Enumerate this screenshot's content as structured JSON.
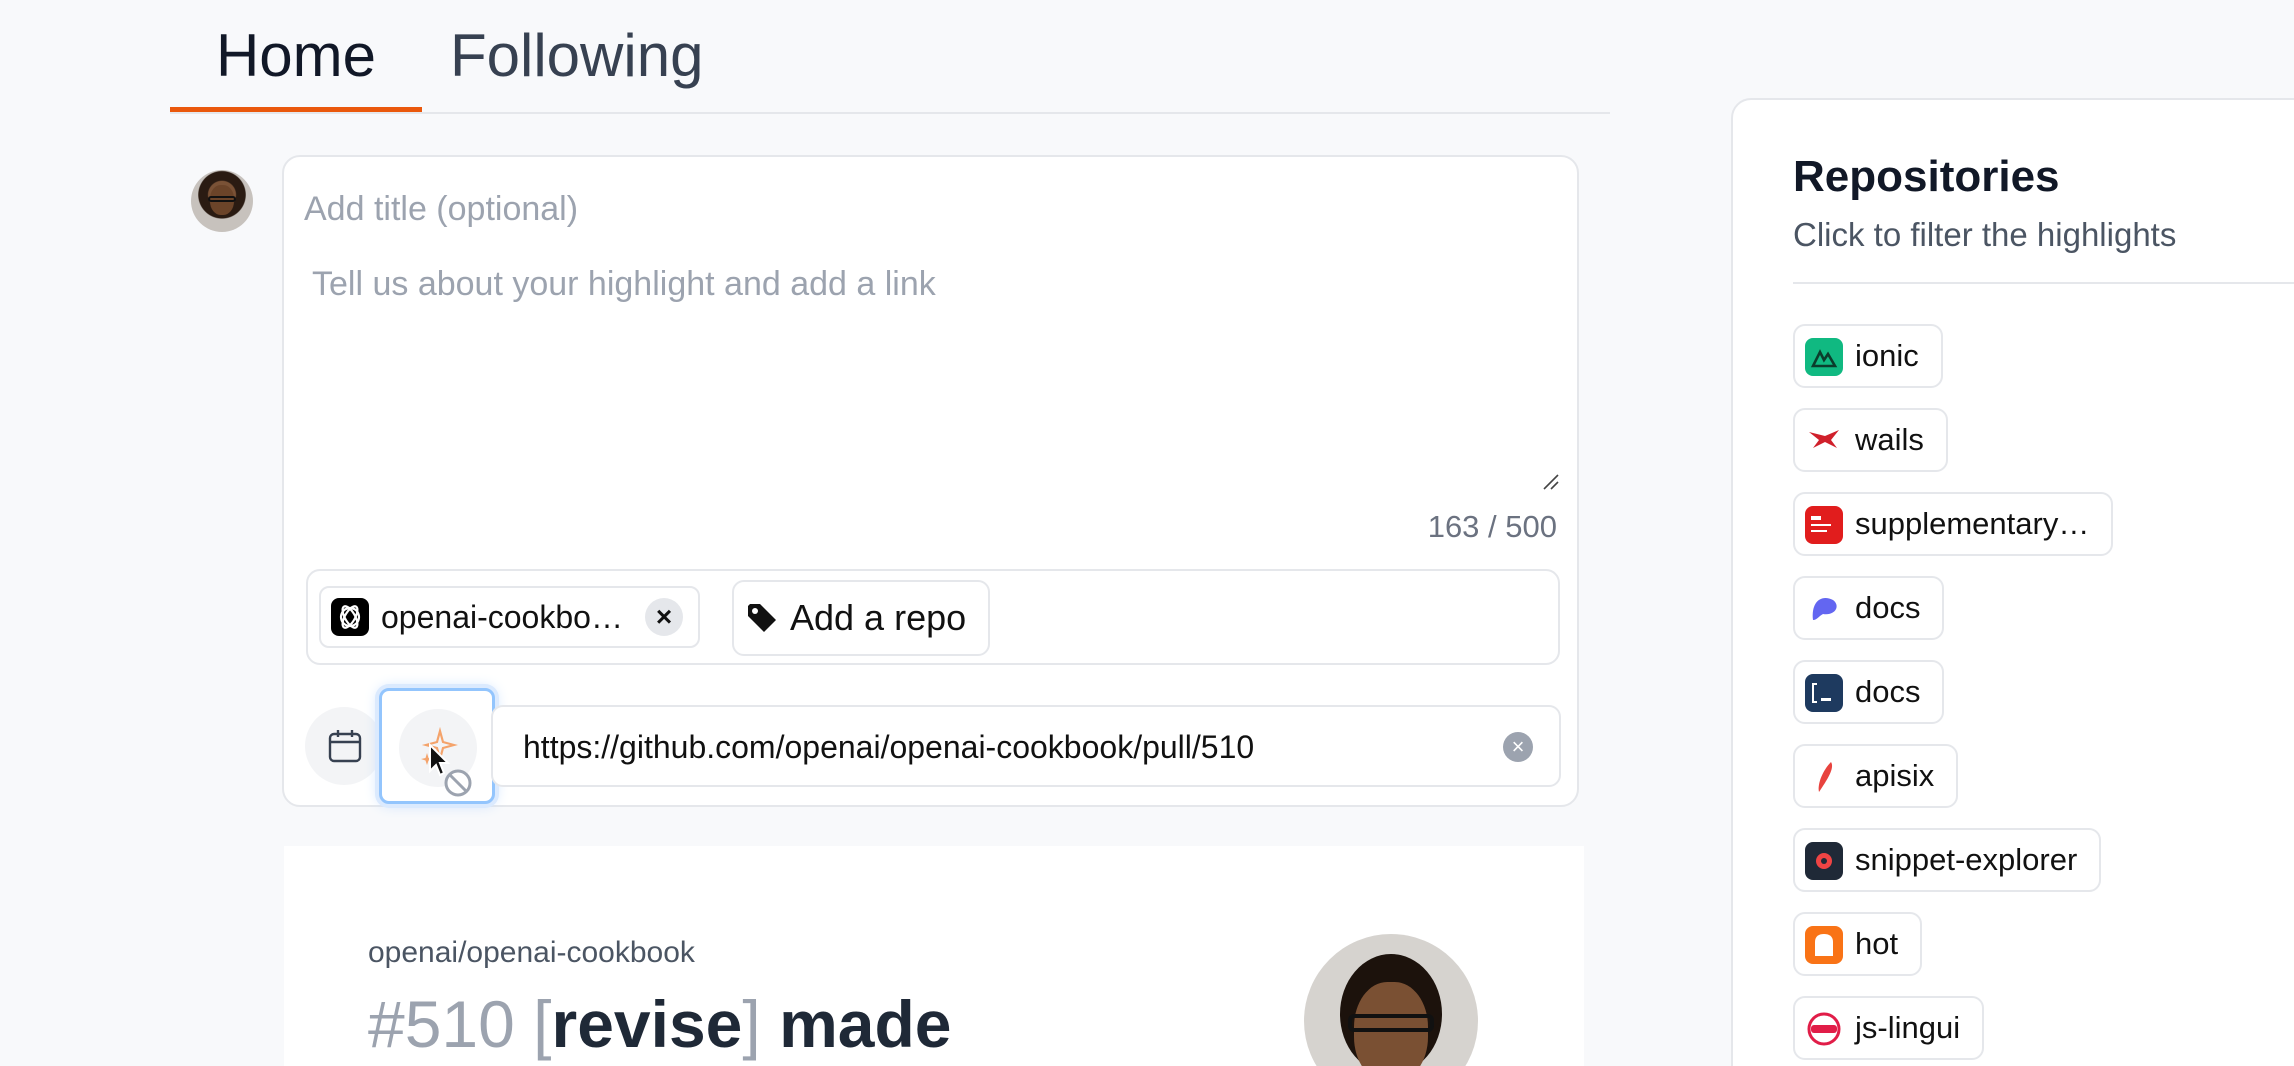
{
  "tabs": [
    {
      "label": "Home",
      "active": true
    },
    {
      "label": "Following",
      "active": false
    }
  ],
  "composer": {
    "title_placeholder": "Add title (optional)",
    "body_placeholder": "Tell us about your highlight and add a link",
    "counter": "163 / 500",
    "selected_repo": "openai-cookbo…",
    "add_repo_label": "Add a repo",
    "url_value": "https://github.com/openai/openai-cookbook/pull/510",
    "remove_icon": "×",
    "clear_icon": "×"
  },
  "preview": {
    "repo": "openai/openai-cookbook",
    "number": "#510",
    "open_bracket": "[",
    "tag": "revise",
    "close_bracket": "]",
    "rest": "made"
  },
  "sidebar": {
    "title": "Repositories",
    "subtitle": "Click to filter the highlights",
    "repos": [
      {
        "name": "ionic",
        "color": "#10b981"
      },
      {
        "name": "wails",
        "color": "#ffffff"
      },
      {
        "name": "supplementary…",
        "color": "#e11d1d"
      },
      {
        "name": "docs",
        "color": "#6366f1"
      },
      {
        "name": "docs",
        "color": "#1e3a5f"
      },
      {
        "name": "apisix",
        "color": "#ffffff"
      },
      {
        "name": "snippet-explorer",
        "color": "#1f2937"
      },
      {
        "name": "hot",
        "color": "#f97316"
      },
      {
        "name": "js-lingui",
        "color": "#ffffff"
      }
    ]
  },
  "colors": {
    "accent": "#ea580c",
    "focus_ring": "#93c5fd"
  }
}
